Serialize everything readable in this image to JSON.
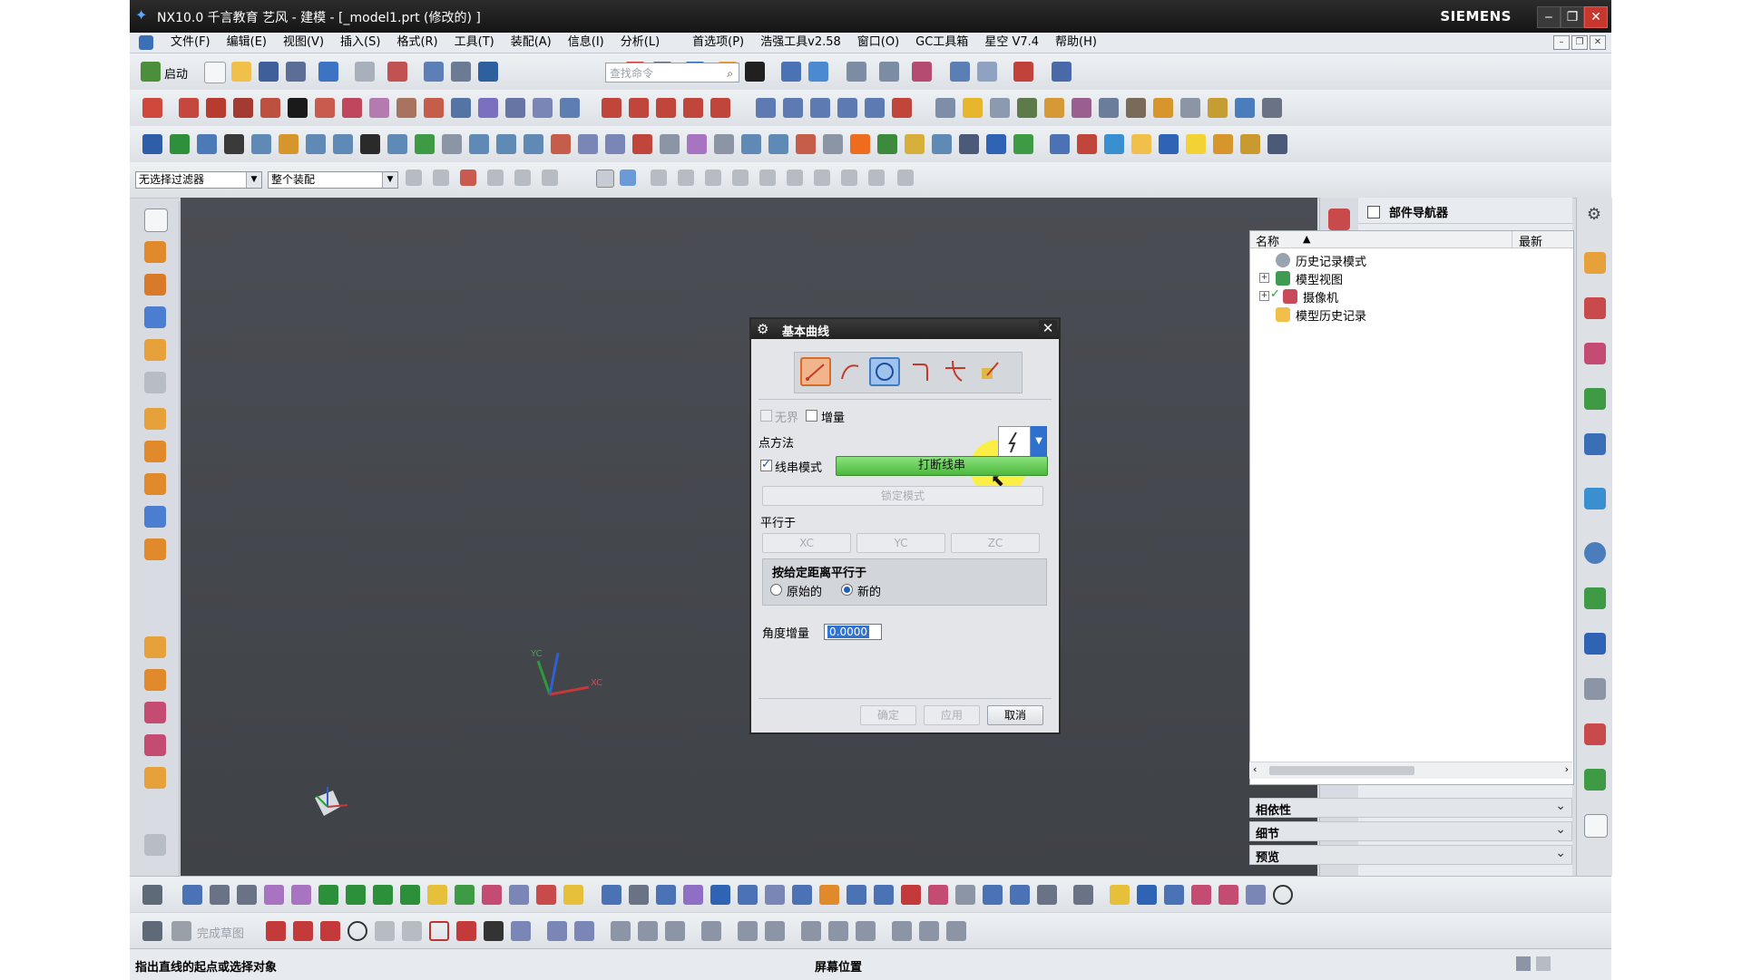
{
  "window": {
    "title": "NX10.0 千言教育 艺风 - 建模 - [_model1.prt (修改的) ]",
    "brand": "SIEMENS",
    "minimize": "‒",
    "maximize": "❐",
    "close": "✕"
  },
  "menubar": {
    "items": [
      "文件(F)",
      "编辑(E)",
      "视图(V)",
      "插入(S)",
      "格式(R)",
      "工具(T)",
      "装配(A)",
      "信息(I)",
      "分析(L)",
      "首选项(P)",
      "浩强工具v2.58",
      "窗口(O)",
      "GC工具箱",
      "星空 V7.4",
      "帮助(H)"
    ]
  },
  "toolbar": {
    "start_label": "启动",
    "search_placeholder": "查找命令",
    "filter_select": "无选择过滤器",
    "assembly_select": "整个装配"
  },
  "navigator": {
    "title": "部件导航器",
    "col_name": "名称",
    "col_latest": "最新",
    "nodes": [
      {
        "label": "历史记录模式",
        "expander": ""
      },
      {
        "label": "模型视图",
        "expander": "+"
      },
      {
        "label": "摄像机",
        "expander": "+"
      },
      {
        "label": "模型历史记录",
        "expander": ""
      }
    ],
    "panels": [
      "相依性",
      "细节",
      "预览"
    ]
  },
  "dialog": {
    "title": "基本曲线",
    "unbounded_label": "无界",
    "incremental_label": "增量",
    "point_method_label": "点方法",
    "string_mode_label": "线串模式",
    "break_string_label": "打断线串",
    "lock_mode_label": "锁定模式",
    "parallel_to_label": "平行于",
    "xc_label": "XC",
    "yc_label": "YC",
    "zc_label": "ZC",
    "offset_group_label": "按给定距离平行于",
    "original_label": "原始的",
    "new_label": "新的",
    "angle_increment_label": "角度增量",
    "angle_increment_value": "0.0000",
    "ok_label": "确定",
    "apply_label": "应用",
    "cancel_label": "取消",
    "string_mode_checked": true,
    "incremental_checked": false,
    "unbounded_checked": false,
    "new_selected": true
  },
  "viewport": {
    "triad_x": "XC",
    "triad_y": "YC"
  },
  "bottombar": {
    "finish_sketch_label": "完成草图"
  },
  "statusbar": {
    "message": "指出直线的起点或选择对象",
    "screen_position": "屏幕位置"
  },
  "colors": {
    "titlebar": "#1e1e1e",
    "viewport": "#45484e",
    "accent_blue": "#2f6fcd",
    "green_button": "#5cc24c",
    "highlight_yellow": "#fff028"
  }
}
